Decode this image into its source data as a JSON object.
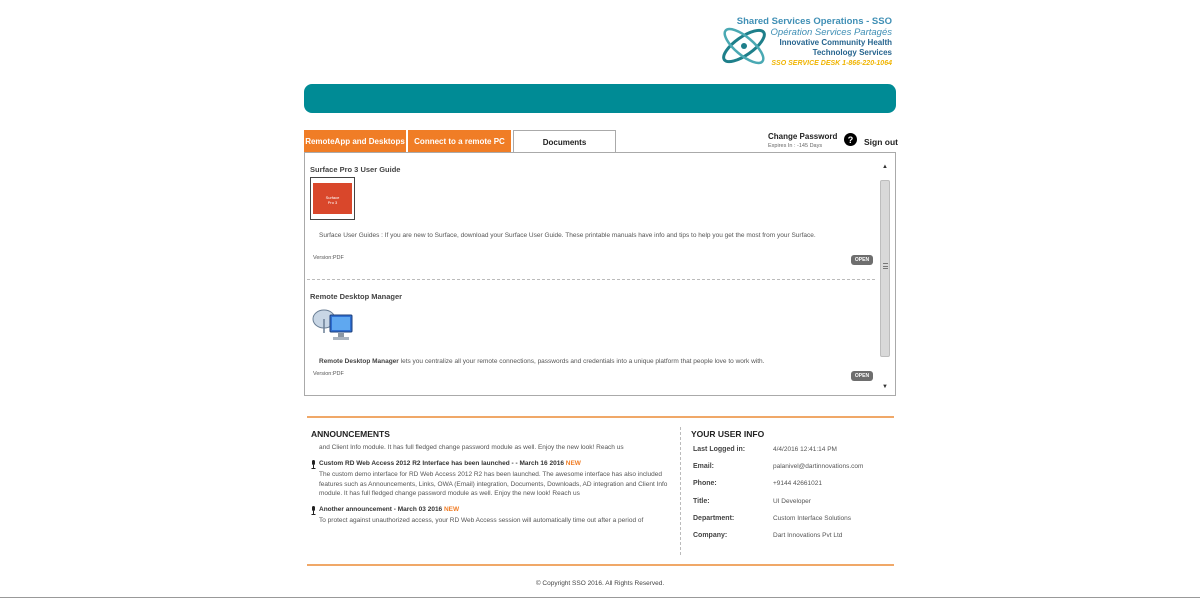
{
  "logo": {
    "line1": "Shared  Services  Operations  - SSO",
    "line2": "Opération  Services Partagés",
    "line3": "Innovative Community Health",
    "line4": "Technology Services",
    "line5": "SSO SERVICE DESK  1-866-220-1064",
    "icon": "atom-swirl-logo"
  },
  "tabs": [
    {
      "label": "RemoteApp and Desktops"
    },
    {
      "label": "Connect to a remote PC"
    },
    {
      "label": "Documents"
    }
  ],
  "account": {
    "change_password": "Change Password",
    "expires": "Expires In : -145 Days",
    "help_symbol": "?",
    "sign_out": "Sign out"
  },
  "documents": [
    {
      "title": "Surface Pro 3 User Guide",
      "thumb_label": "Surface\nPro 3",
      "description": "Surface User Guides : If you are new to Surface, download your Surface User Guide. These printable manuals have info and tips to help you get the most from your Surface.",
      "version": "Version:PDF",
      "open": "OPEN"
    },
    {
      "title": "Remote Desktop Manager",
      "description_bold": "Remote Desktop Manager",
      "description": " lets you centralize all your remote connections, passwords and credentials into a unique platform that people love to work with.",
      "version": "Version:PDF",
      "open": "OPEN"
    }
  ],
  "announcements": {
    "title": "ANNOUNCEMENTS",
    "lead_text": "and Client Info module. It has full fledged change password module as well. Enjoy the new look! Reach us",
    "items": [
      {
        "heading": "Custom RD Web Access 2012 R2 Interface has been launched - - March 16 2016",
        "badge": "NEW",
        "body": "The custom demo interface for RD Web Access 2012 R2 has been launched. The awesome interface has also included features such as Announcements, Links, OWA (Email) integration, Documents, Downloads, AD integration and Client Info module. It has full fledged change password module as well. Enjoy the new look! Reach us"
      },
      {
        "heading": "Another announcement - March 03 2016",
        "badge": "NEW",
        "body": "To protect against unauthorized access, your RD Web Access session will automatically time out after a period of"
      }
    ]
  },
  "user_info": {
    "title": "YOUR USER INFO",
    "rows": [
      {
        "label": "Last Logged in:",
        "value": "4/4/2016 12:41:14 PM"
      },
      {
        "label": "Email:",
        "value": "palanivel@dartinnovations.com"
      },
      {
        "label": "Phone:",
        "value": "+9144 42661021"
      },
      {
        "label": "Title:",
        "value": "UI Developer"
      },
      {
        "label": "Department:",
        "value": "Custom Interface Solutions"
      },
      {
        "label": "Company:",
        "value": "Dart Innovations Pvt Ltd"
      }
    ]
  },
  "footer": "© Copyright SSO 2016. All Rights Reserved.",
  "colors": {
    "accent_orange": "#f07d26",
    "banner_teal": "#008b95",
    "logo_blue": "#3f8fb5",
    "logo_yellow": "#f0b400"
  }
}
